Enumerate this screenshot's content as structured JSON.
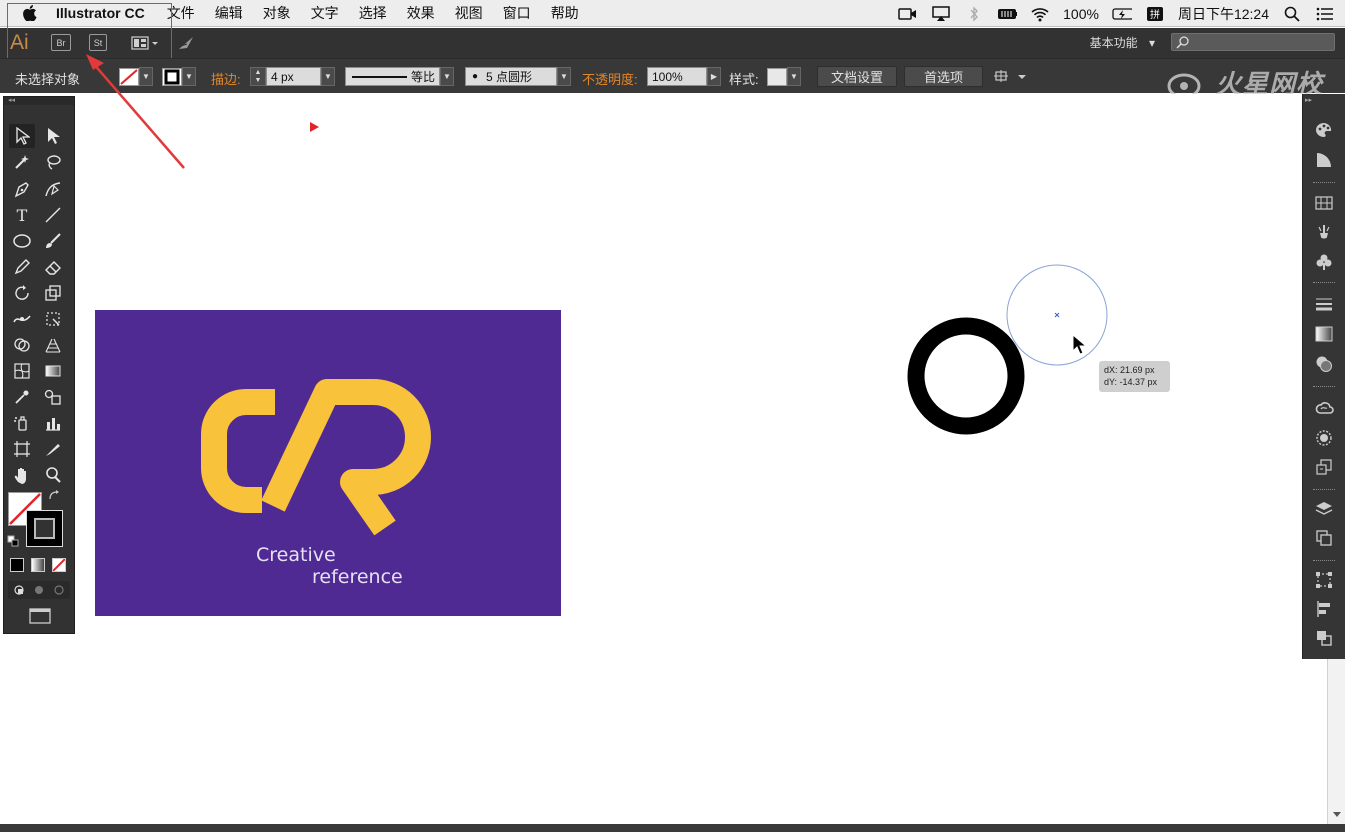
{
  "menubar": {
    "app_name": "Illustrator CC",
    "menus": [
      "文件",
      "编辑",
      "对象",
      "文字",
      "选择",
      "效果",
      "视图",
      "窗口",
      "帮助"
    ],
    "battery": "100%",
    "clock": "周日下午12:24"
  },
  "appbar": {
    "logo": "Ai",
    "bridge": "Br",
    "stock": "St",
    "workspace": "基本功能",
    "workspace_caret": "▾"
  },
  "controlbar": {
    "selection_status": "未选择对象",
    "stroke_label": "描边:",
    "stroke_value": "4 px",
    "profile_label": "等比",
    "brush_label": "5 点圆形",
    "opacity_label": "不透明度:",
    "opacity_value": "100%",
    "style_label": "样式:",
    "doc_setup_button": "文档设置",
    "preferences_button": "首选项"
  },
  "watermark": "火星网校",
  "artboard": {
    "logo_line1": "Creative",
    "logo_line2": "reference",
    "bg_color": "#4f2a93",
    "logo_color": "#f8c23b"
  },
  "tooltip": {
    "dx": "dX: 21.69 px",
    "dy": "dY: -14.37 px"
  },
  "colors": {
    "accent_orange": "#e0872a",
    "highlight_red": "#e03a3a",
    "ui_dark": "#323232"
  }
}
